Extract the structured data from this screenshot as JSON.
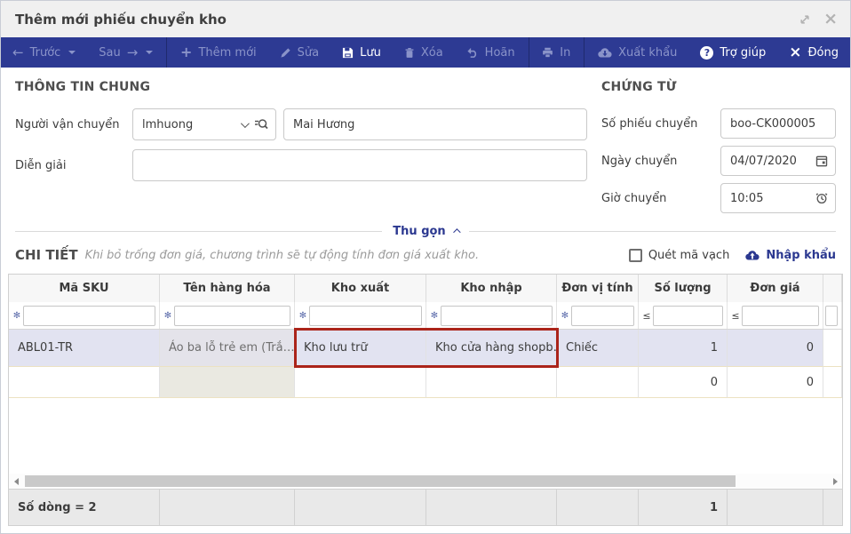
{
  "dialog": {
    "title": "Thêm mới phiếu chuyển kho"
  },
  "toolbar": {
    "prev": "Trước",
    "next": "Sau",
    "add": "Thêm mới",
    "edit": "Sửa",
    "save": "Lưu",
    "delete": "Xóa",
    "undo": "Hoãn",
    "print": "In",
    "export": "Xuất khẩu",
    "help": "Trợ giúp",
    "close": "Đóng"
  },
  "general": {
    "heading": "THÔNG TIN CHUNG",
    "carrier_label": "Người vận chuyển",
    "carrier_code": "lmhuong",
    "carrier_name": "Mai Hương",
    "description_label": "Diễn giải",
    "description_value": ""
  },
  "document": {
    "heading": "CHỨNG TỪ",
    "number_label": "Số phiếu chuyển",
    "number_value": "boo-CK000005",
    "date_label": "Ngày chuyển",
    "date_value": "04/07/2020",
    "time_label": "Giờ chuyển",
    "time_value": "10:05"
  },
  "collapse_label": "Thu gọn",
  "detail": {
    "heading": "CHI TIẾT",
    "hint": "Khi bỏ trống đơn giá, chương trình sẽ tự động tính đơn giá xuất kho.",
    "barcode_label": "Quét mã vạch",
    "import_label": "Nhập khẩu"
  },
  "table": {
    "columns": [
      "Mã SKU",
      "Tên hàng hóa",
      "Kho xuất",
      "Kho nhập",
      "Đơn vị tính",
      "Số lượng",
      "Đơn giá"
    ],
    "rows": [
      {
        "sku": "ABL01-TR",
        "name": "Áo ba lỗ trẻ em (Trắ…",
        "from": "Kho lưu trữ",
        "to": "Kho cửa hàng shopb…",
        "unit": "Chiếc",
        "qty": "1",
        "price": "0"
      },
      {
        "sku": "",
        "name": "",
        "from": "",
        "to": "",
        "unit": "",
        "qty": "0",
        "price": "0"
      }
    ],
    "footer": {
      "label": "Số dòng = 2",
      "qty_total": "1"
    }
  },
  "colors": {
    "accent": "#2d3a93",
    "selected_row": "#e2e3f1",
    "annotation": "#ab241a"
  }
}
